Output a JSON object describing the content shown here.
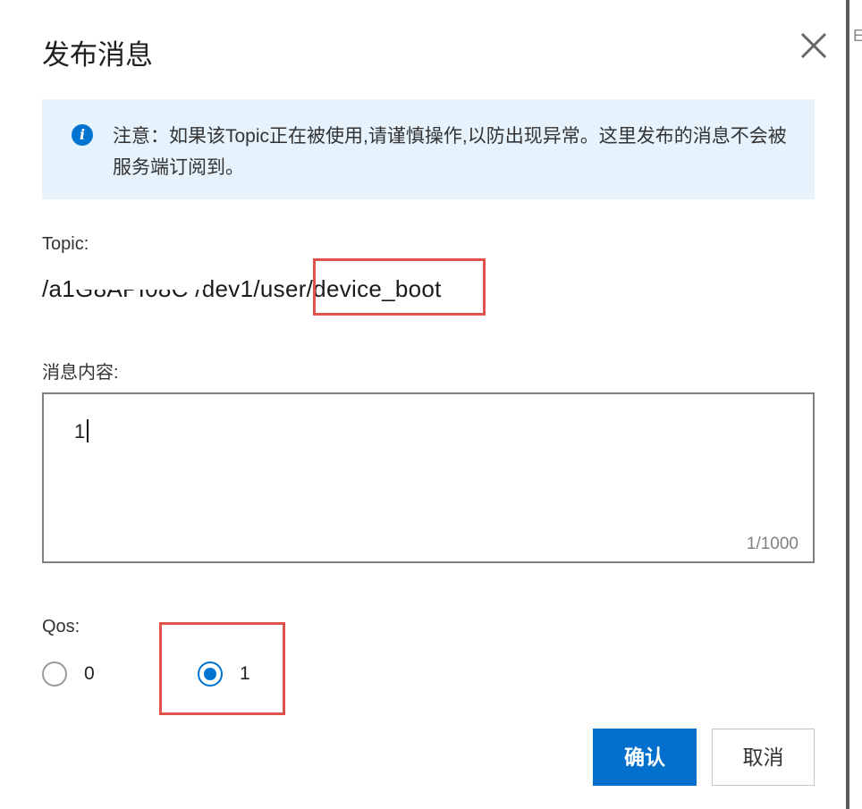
{
  "dialog": {
    "title": "发布消息",
    "close_icon": "close-icon"
  },
  "notice": {
    "icon": "info-icon",
    "icon_glyph": "i",
    "text": "注意：如果该Topic正在被使用,请谨慎操作,以防出现异常。这里发布的消息不会被服务端订阅到。"
  },
  "topic": {
    "label": "Topic:",
    "value": "/a1G8API08C /dev1/user/device_boot"
  },
  "message": {
    "label": "消息内容:",
    "value": "1",
    "counter": "1/1000"
  },
  "qos": {
    "label": "Qos:",
    "options": [
      {
        "label": "0",
        "selected": false
      },
      {
        "label": "1",
        "selected": true
      }
    ]
  },
  "buttons": {
    "confirm": "确认",
    "cancel": "取消"
  },
  "colors": {
    "primary": "#0070cc",
    "notice_bg": "#e6f3fd",
    "highlight_red": "#e0524c"
  }
}
